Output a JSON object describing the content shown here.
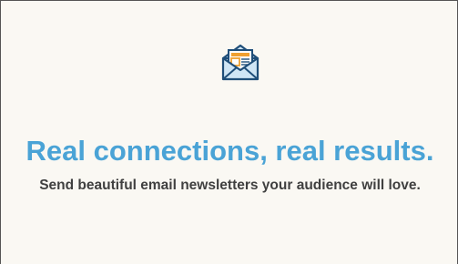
{
  "hero": {
    "icon": "open-envelope-newsletter-icon",
    "headline": "Real connections, real results.",
    "subheadline": "Send beautiful email newsletters your audience will love.",
    "colors": {
      "background": "#faf8f3",
      "headline": "#4aa3d6",
      "subheadline": "#404040",
      "icon_stroke": "#1f4e79",
      "icon_fill": "#cfe5f5",
      "icon_accent": "#f0a030"
    }
  }
}
